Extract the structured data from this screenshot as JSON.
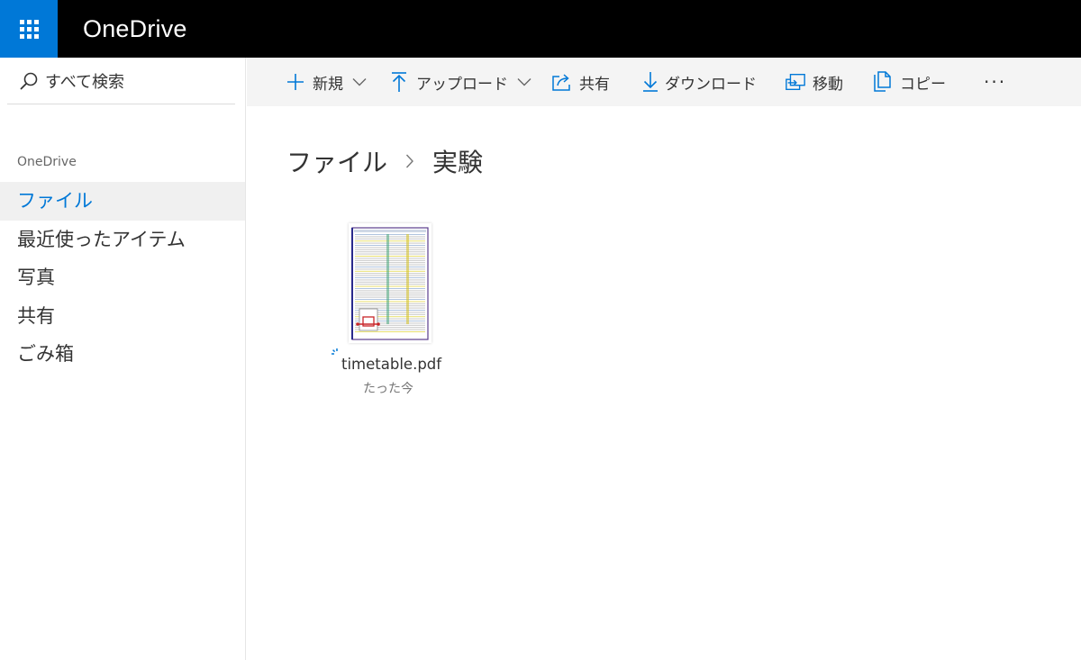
{
  "app": {
    "brand": "OneDrive",
    "accent_color": "#0078d7",
    "waffle_icon": "app-launcher-icon"
  },
  "search": {
    "placeholder": "すべて検索",
    "icon": "search-icon"
  },
  "nav": {
    "section_title": "OneDrive",
    "items": [
      {
        "label": "ファイル",
        "active": true
      },
      {
        "label": "最近使ったアイテム",
        "active": false
      },
      {
        "label": "写真",
        "active": false
      },
      {
        "label": "共有",
        "active": false
      },
      {
        "label": "ごみ箱",
        "active": false
      }
    ]
  },
  "commands": {
    "new": {
      "label": "新規",
      "icon": "plus-icon"
    },
    "upload": {
      "label": "アップロード",
      "icon": "upload-arrow-icon"
    },
    "share": {
      "label": "共有",
      "icon": "share-icon"
    },
    "download": {
      "label": "ダウンロード",
      "icon": "download-arrow-icon"
    },
    "move": {
      "label": "移動",
      "icon": "move-icon"
    },
    "copy": {
      "label": "コピー",
      "icon": "copy-icon"
    },
    "more": {
      "label": "···",
      "icon": "more-icon"
    }
  },
  "breadcrumb": {
    "root": "ファイル",
    "current": "実験"
  },
  "files": [
    {
      "name": "timetable.pdf",
      "modified": "たった今",
      "type_icon": "pdf-file-icon"
    }
  ]
}
